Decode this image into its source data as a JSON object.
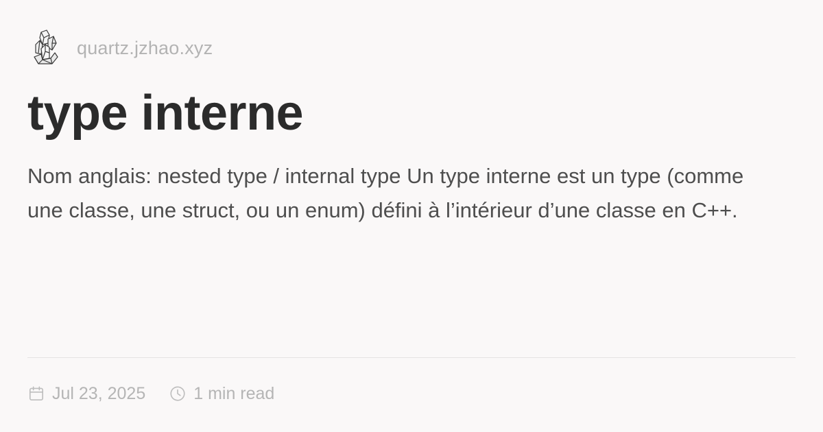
{
  "site": {
    "logo_icon": "crystal-logo-icon",
    "domain": "quartz.jzhao.xyz"
  },
  "page": {
    "title": "type interne",
    "description": "Nom anglais: nested type / internal type Un type interne est un type (comme une classe, une struct, ou un enum) défini à l’intérieur d’une classe en C++."
  },
  "meta": {
    "date_icon": "calendar-icon",
    "date": "Jul 23, 2025",
    "reading_time_icon": "clock-icon",
    "reading_time": "1 min read"
  },
  "colors": {
    "background": "#faf8f8",
    "title": "#2b2b2b",
    "body_text": "#4e4e4e",
    "muted": "#b5b5b5",
    "divider": "#e5e3e3"
  }
}
